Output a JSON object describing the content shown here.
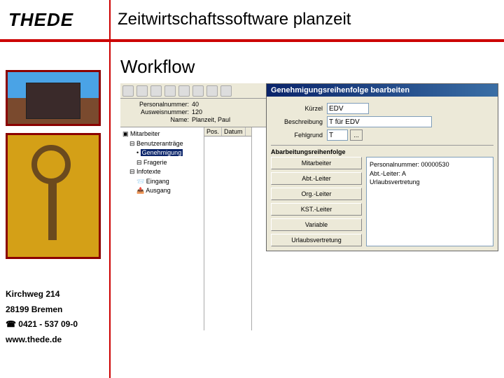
{
  "brand": "THEDE",
  "slide_title": "Zeitwirtschaftssoftware planzeit",
  "section_heading": "Workflow",
  "address": {
    "street": "Kirchweg 214",
    "city": "28199 Bremen",
    "phone": "☎ 0421 - 537 09-0",
    "web": "www.thede.de"
  },
  "app": {
    "details": {
      "personalnummer_label": "Personalnummer:",
      "personalnummer_value": "40",
      "ausweisnummer_label": "Ausweisnummer:",
      "ausweisnummer_value": "120",
      "name_label": "Name:",
      "name_value": "Planzeit, Paul"
    },
    "tree": {
      "root": "Mitarbeiter",
      "n1": "Benutzeranträge",
      "n2": "Genehmigung",
      "n3": "Fragerie",
      "n4": "Infotexte",
      "n5": "Eingang",
      "n6": "Ausgang"
    },
    "grid": {
      "col1": "Pos.",
      "col2": "Datum"
    }
  },
  "dialog": {
    "title": "Genehmigungsreihenfolge bearbeiten",
    "form": {
      "kuerzel_label": "Kürzel",
      "kuerzel_value": "EDV",
      "beschreibung_label": "Beschreibung",
      "beschreibung_value": "T für EDV",
      "fehlgrund_label": "Fehlgrund",
      "fehlgrund_value": "T"
    },
    "section_label": "Abarbeitungsreihenfolge",
    "buttons": {
      "b1": "Mitarbeiter",
      "b2": "Abt.-Leiter",
      "b3": "Org.-Leiter",
      "b4": "KST.-Leiter",
      "b5": "Variable",
      "b6": "Urlaubsvertretung"
    },
    "info": {
      "l1": "Personalnummer: 00000530",
      "l2": "Abt.-Leiter: A",
      "l3": "Urlaubsvertretung"
    }
  }
}
